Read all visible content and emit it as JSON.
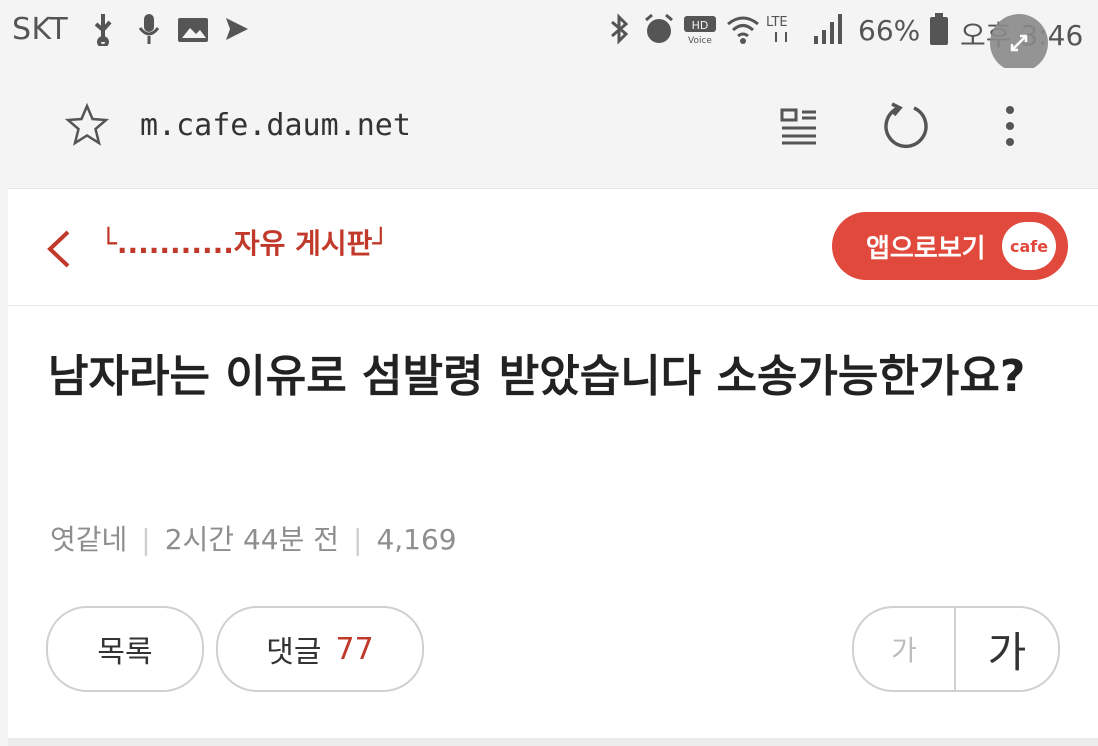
{
  "status_bar": {
    "carrier": "SKT",
    "battery": "66%",
    "time": "오후 3:46",
    "icons": [
      "usb-icon",
      "mic-icon",
      "image-icon",
      "send-icon",
      "bluetooth-icon",
      "alarm-icon",
      "hd-voice-icon",
      "wifi-icon",
      "lte-icon",
      "signal-icon",
      "battery-icon"
    ]
  },
  "browser": {
    "url": "m.cafe.daum.net"
  },
  "cafe_header": {
    "board_name": "└...........자유 게시판┘",
    "app_button_label": "앱으로보기",
    "app_logo_text": "cafe",
    "accent_color": "#e0493c"
  },
  "post": {
    "title": "남자라는 이유로 섬발령 받았습니다 소송가능한가요?",
    "author": "엿같네",
    "time_ago": "2시간 44분 전",
    "views": "4,169"
  },
  "actions": {
    "list_label": "목록",
    "comment_label": "댓글",
    "comment_count": "77",
    "font_small": "가",
    "font_large": "가"
  }
}
